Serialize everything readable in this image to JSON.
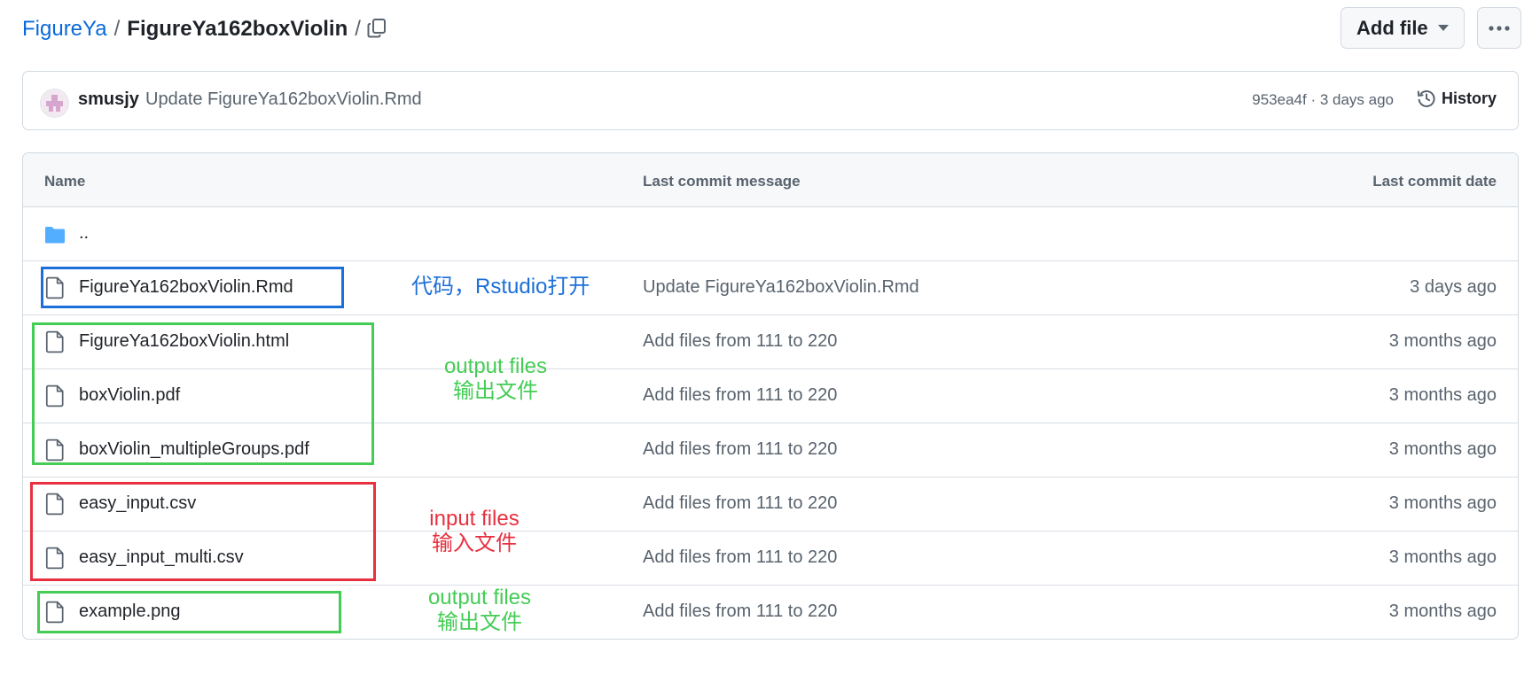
{
  "breadcrumb": {
    "repo": "FigureYa",
    "separator": "/",
    "folder": "FigureYa162boxViolin",
    "trailing": "/"
  },
  "toolbar": {
    "add_file_label": "Add file"
  },
  "commit": {
    "author": "smusjy",
    "message": "Update FigureYa162boxViolin.Rmd",
    "meta": "953ea4f · 3 days ago",
    "history_label": "History"
  },
  "table": {
    "headers": {
      "name": "Name",
      "message": "Last commit message",
      "date": "Last commit date"
    },
    "parent_dir": "..",
    "rows": [
      {
        "name": "FigureYa162boxViolin.Rmd",
        "message": "Update FigureYa162boxViolin.Rmd",
        "date": "3 days ago"
      },
      {
        "name": "FigureYa162boxViolin.html",
        "message": "Add files from 111 to 220",
        "date": "3 months ago"
      },
      {
        "name": "boxViolin.pdf",
        "message": "Add files from 111 to 220",
        "date": "3 months ago"
      },
      {
        "name": "boxViolin_multipleGroups.pdf",
        "message": "Add files from 111 to 220",
        "date": "3 months ago"
      },
      {
        "name": "easy_input.csv",
        "message": "Add files from 111 to 220",
        "date": "3 months ago"
      },
      {
        "name": "easy_input_multi.csv",
        "message": "Add files from 111 to 220",
        "date": "3 months ago"
      },
      {
        "name": "example.png",
        "message": "Add files from 111 to 220",
        "date": "3 months ago"
      }
    ]
  },
  "annotations": {
    "code": "代码，Rstudio打开",
    "output_1": {
      "line1": "output files",
      "line2": "输出文件"
    },
    "input": {
      "line1": "input files",
      "line2": "输入文件"
    },
    "output_2": {
      "line1": "output files",
      "line2": "输出文件"
    }
  },
  "icons": {
    "copy": "copy-icon",
    "dropdown": "triangle-down-icon",
    "more": "kebab-horizontal-icon",
    "history": "history-icon",
    "folder": "folder-icon",
    "file": "file-icon"
  },
  "colors": {
    "link": "#0969da",
    "folder_icon": "#54aeff",
    "annotation_blue": "#1c6fd8",
    "annotation_green": "#44cc55",
    "annotation_red": "#e83040"
  }
}
